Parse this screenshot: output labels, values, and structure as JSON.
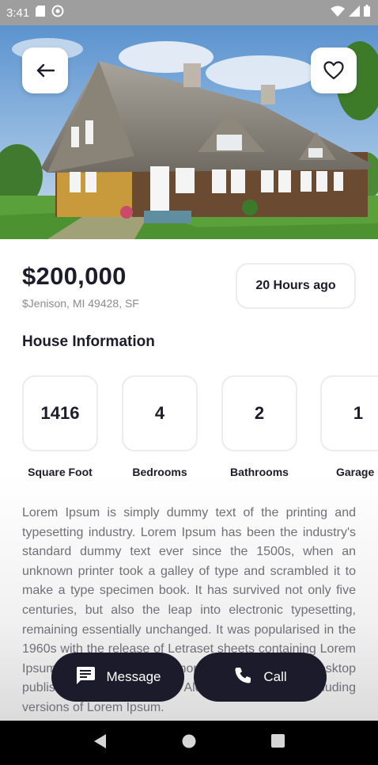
{
  "status_bar": {
    "time": "3:41",
    "icons": [
      "sd-card-icon",
      "sync-icon",
      "wifi-icon",
      "signal-icon",
      "battery-icon"
    ]
  },
  "hero": {
    "image": "thatched-roof-house-photo",
    "back_icon": "arrow-left-icon",
    "favorite_icon": "heart-outline-icon"
  },
  "listing": {
    "price": "$200,000",
    "address": "$Jenison, MI 49428, SF",
    "posted": "20 Hours ago"
  },
  "house_info": {
    "title": "House Information",
    "stats": [
      {
        "value": "1416",
        "label": "Square Foot"
      },
      {
        "value": "4",
        "label": "Bedrooms"
      },
      {
        "value": "2",
        "label": "Bathrooms"
      },
      {
        "value": "1",
        "label": "Garage"
      }
    ]
  },
  "description": "Lorem Ipsum is simply dummy text of the printing and typesetting industry. Lorem Ipsum has been the industry's standard dummy text ever since the 1500s, when an unknown printer took a galley of type and scrambled it to make a type specimen book. It has survived not only five centuries, but also the leap into electronic typesetting, remaining essentially unchanged. It was popularised in the 1960s with the release of Letraset sheets containing Lorem Ipsum passages, and more recently with desktop publishing software like Aldus PageMaker including versions of Lorem Ipsum.",
  "actions": {
    "message_label": "Message",
    "message_icon": "message-icon",
    "call_label": "Call",
    "call_icon": "phone-icon"
  },
  "nav_bar": {
    "back_icon": "nav-back-icon",
    "home_icon": "nav-home-icon",
    "recents_icon": "nav-recents-icon"
  },
  "colors": {
    "primary_dark": "#1b1b2b",
    "text_dark": "#1c1c2a",
    "text_muted": "#8a8a92",
    "border": "#ececef"
  }
}
